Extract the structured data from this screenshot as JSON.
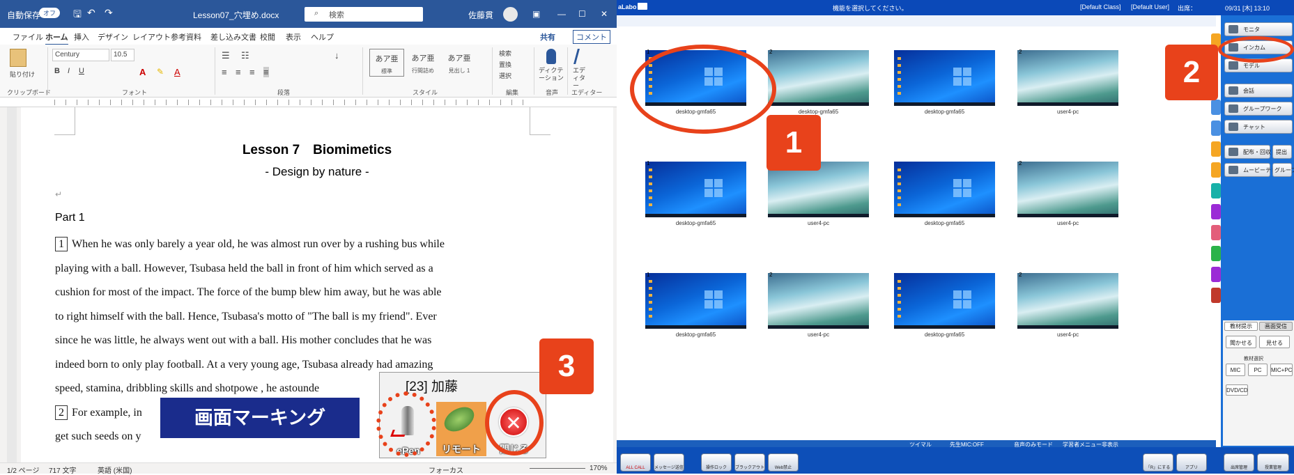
{
  "word": {
    "titlebar": {
      "autosave": "自動保存",
      "autosave_state": "オフ",
      "filename": "Lesson07_穴埋め.docx",
      "search_placeholder": "検索",
      "user": "佐藤貫"
    },
    "menu_tabs": [
      "ファイル",
      "ホーム",
      "挿入",
      "デザイン",
      "レイアウト",
      "参考資料",
      "差し込み文書",
      "校閲",
      "表示",
      "ヘルプ"
    ],
    "share_label": "共有",
    "comment_label": "コメント",
    "ribbon": {
      "paste_label": "貼り付け",
      "font_name": "Century",
      "font_size": "10.5",
      "styles": [
        {
          "sample": "あア亜",
          "name": "標準"
        },
        {
          "sample": "あア亜",
          "name": "行間詰め"
        },
        {
          "sample": "あア亜",
          "name": "見出し 1"
        }
      ],
      "find_label": "検索",
      "replace_label": "置換",
      "select_label": "選択",
      "dictate_label": "ディクテーション",
      "editor_label": "エディター",
      "groups": [
        "クリップボード",
        "フォント",
        "段落",
        "スタイル",
        "編集",
        "音声",
        "エディター"
      ]
    },
    "document": {
      "title": "Lesson 7　Biomimetics",
      "subtitle": "- Design by nature -",
      "part": "Part 1",
      "paragraph_numbers": [
        "1",
        "2"
      ],
      "lines": [
        "When he was only barely a year old, he was almost run over by a rushing bus while",
        "playing with a ball. However, Tsubasa held the ball in front of him which served as a",
        "cushion for most of the impact. The force of the bump blew him away, but he was able",
        "to right himself with the ball. Hence, Tsubasa's motto of \"The ball is my friend\". Ever",
        "since he was little, he always went out with a ball. His mother concludes that he was",
        "indeed born to only play football. At a very young age, Tsubasa already had amazing",
        "speed, stamina, dribbling skills and shotpowe , he astounde",
        "For example, in",
        "get such seeds on y"
      ]
    },
    "status": {
      "page": "1/2 ページ",
      "words": "717 文字",
      "lang": "英語 (米国)",
      "focus": "フォーカス",
      "zoom": "170%"
    }
  },
  "overlay": {
    "marking_label": "画面マーキング",
    "student_label": "[23] 加藤",
    "tools": [
      {
        "label": "ePen",
        "icon": "pen-icon"
      },
      {
        "label": "リモート",
        "icon": "mouse-icon"
      },
      {
        "label": "閉じる",
        "icon": "close-icon"
      }
    ],
    "markers": [
      "1",
      "2",
      "3"
    ]
  },
  "classroom": {
    "app_name": "aLabo",
    "prompt": "機能を選択してください。",
    "class_name": "[Default Class]",
    "user_name": "[Default User]",
    "attendance": "出席：",
    "datetime": "09/31 [木] 13:10",
    "thumbs": [
      {
        "num": "1",
        "label": "desktop-gmfa65",
        "kind": "win"
      },
      {
        "num": "2",
        "label": "desktop-gmfa65",
        "kind": "scene"
      },
      {
        "num": "",
        "label": "desktop-gmfa65",
        "kind": "win"
      },
      {
        "num": "2",
        "label": "user4-pc",
        "kind": "scene"
      },
      {
        "num": "1",
        "label": "desktop-gmfa65",
        "kind": "win"
      },
      {
        "num": "2",
        "label": "user4-pc",
        "kind": "scene"
      },
      {
        "num": "",
        "label": "desktop-gmfa65",
        "kind": "win"
      },
      {
        "num": "2",
        "label": "user4-pc",
        "kind": "scene"
      },
      {
        "num": "1",
        "label": "desktop-gmfa65",
        "kind": "win"
      },
      {
        "num": "2",
        "label": "user4-pc",
        "kind": "scene"
      },
      {
        "num": "",
        "label": "desktop-gmfa65",
        "kind": "win"
      },
      {
        "num": "2",
        "label": "user4-pc",
        "kind": "scene"
      }
    ],
    "right_buttons": [
      "モニタ",
      "インカム",
      "モデル",
      "会話",
      "グループワーク",
      "チャット",
      "配布・回収",
      "提出",
      "ムービーテレコ",
      "グループ"
    ],
    "lower": {
      "tab1": "教材提示",
      "tab2": "画面受信",
      "show1": "聞かせる",
      "show2": "見せる",
      "mic_header": "教材選択",
      "mic": "MIC",
      "pc": "PC",
      "micpc": "MIC+PC",
      "dvd": "DVD/CD"
    },
    "midstatus": [
      "ツイマル",
      "先生MIC:OFF",
      "音声のみモード",
      "学習者メニュー非表示"
    ],
    "bottom_buttons": [
      "ALL CALL",
      "メッセージ送信",
      "操作ロック",
      "ブラックアウト",
      "Web禁止",
      "「R」にする",
      "アプリ",
      "出席管理",
      "授業管理"
    ]
  }
}
